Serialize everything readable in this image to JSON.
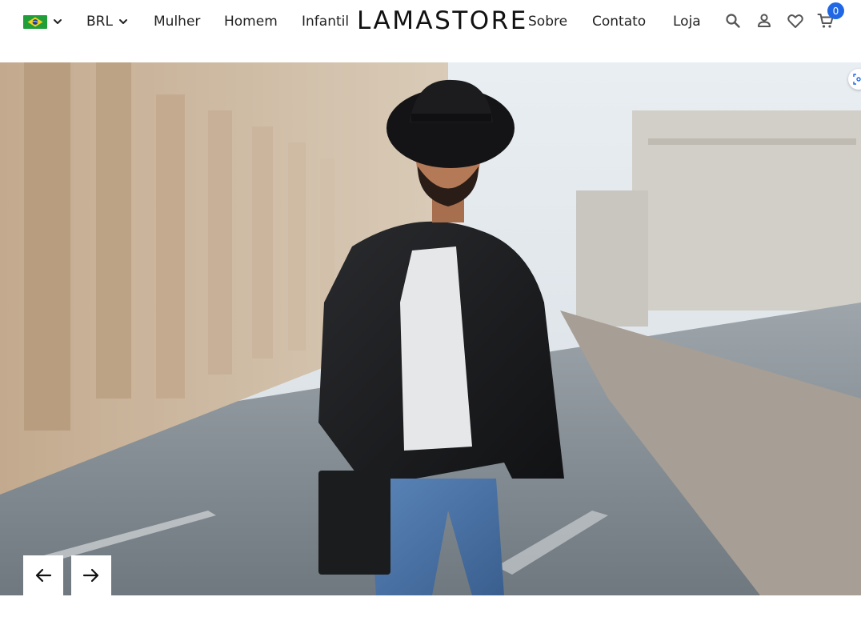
{
  "colors": {
    "accent_badge": "#2067e6",
    "text": "#222222",
    "background": "#ffffff"
  },
  "header": {
    "flag_icon": "brazil-flag-icon",
    "currency": "BRL",
    "logo": "LAMASTORE",
    "left_nav": [
      "Mulher",
      "Homem",
      "Infantil"
    ],
    "right_nav": [
      "Sobre",
      "Contato",
      "Loja"
    ],
    "icons": [
      "search-icon",
      "user-icon",
      "heart-icon",
      "cart-icon"
    ],
    "cart_count": "0"
  },
  "slider": {
    "image_icon": "hero-photo",
    "prev_icon": "arrow-left-icon",
    "next_icon": "arrow-right-icon",
    "zoom_icon": "visual-search-icon"
  }
}
